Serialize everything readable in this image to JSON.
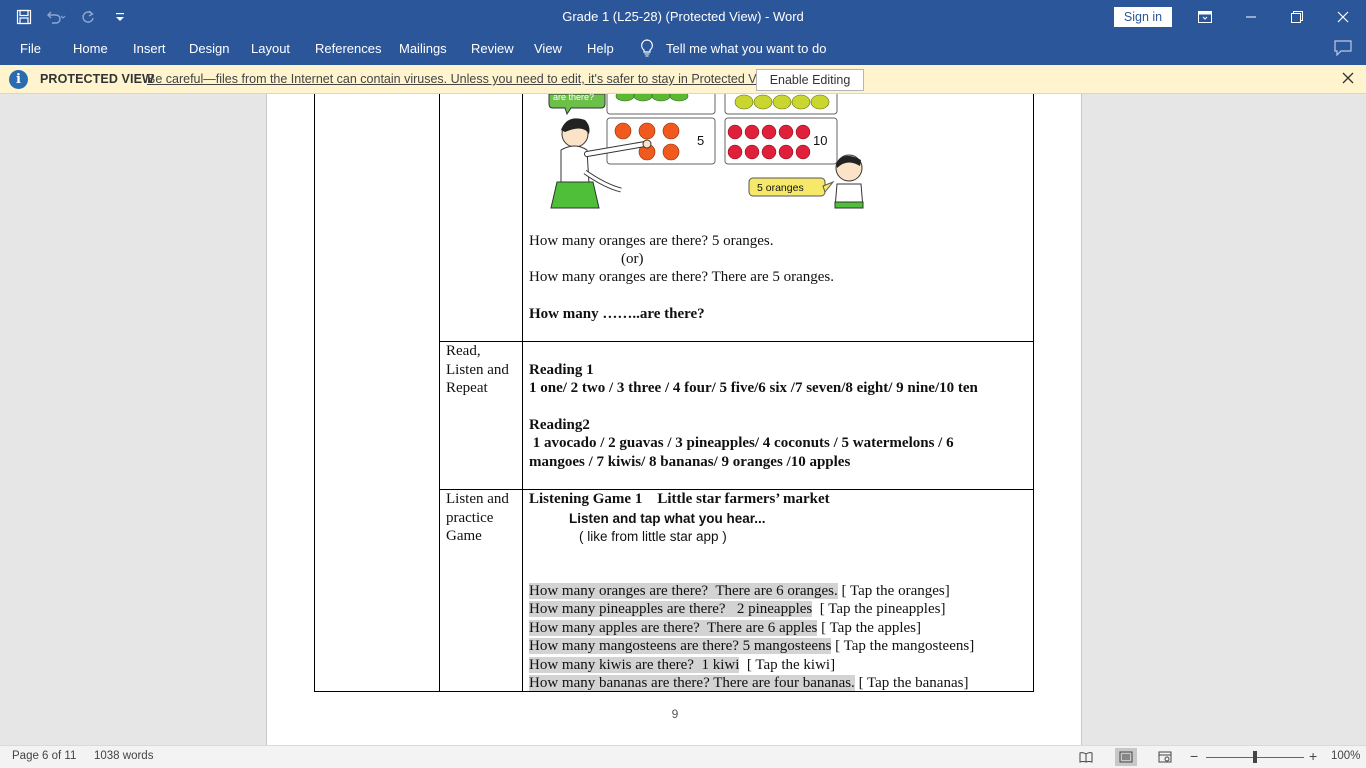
{
  "window": {
    "title": "Grade 1 (L25-28) (Protected View)  -  Word",
    "sign_in": "Sign in"
  },
  "ribbon": {
    "tabs": [
      "File",
      "Home",
      "Insert",
      "Design",
      "Layout",
      "References",
      "Mailings",
      "Review",
      "View",
      "Help"
    ],
    "tell_me": "Tell me what you want to do"
  },
  "protected_view": {
    "title": "PROTECTED VIEW",
    "message": "Be careful—files from the Internet can contain viruses. Unless you need to edit, it's safer to stay in Protected View.",
    "enable_button": "Enable Editing"
  },
  "illustration": {
    "count_small": "5",
    "count_large": "10",
    "speech_child": "5 oranges",
    "speech_teacher_partial": "are there?"
  },
  "document": {
    "intro_lines": {
      "line1": "How many oranges are there?  5 oranges.",
      "line2": "(or)",
      "line3": "How many oranges are there?  There are 5 oranges.",
      "line4": "How many ……..are there?"
    },
    "row_read": {
      "label_1": "Read,",
      "label_2": "Listen and",
      "label_3": "Repeat",
      "reading1_title": "Reading 1",
      "reading1_text": "1 one/ 2 two / 3 three / 4 four/ 5 five/6 six /7 seven/8 eight/ 9 nine/10 ten",
      "reading2_title": "Reading2",
      "reading2_line1": " 1 avocado / 2 guavas / 3 pineapples/ 4 coconuts / 5 watermelons / 6",
      "reading2_line2": "mangoes / 7 kiwis/ 8 bananas/ 9 oranges /10 apples"
    },
    "row_game": {
      "label_1": "Listen and",
      "label_2": "practice",
      "label_3": "Game",
      "title": "Listening Game 1    Little star farmers’ market",
      "subtitle": "Listen  and tap what you hear...",
      "note": "( like from little star app )",
      "qa": [
        {
          "q": "How many oranges are there?  There are 6 oranges.",
          "tap": " [ Tap the oranges]"
        },
        {
          "q": "How many pineapples are there?   2 pineapples",
          "tap": "  [ Tap the pineapples]"
        },
        {
          "q": "How many apples are there?  There are 6 apples",
          "tap": " [ Tap the apples]"
        },
        {
          "q": "How many mangosteens are there? 5 mangosteens",
          "tap": " [ Tap the mangosteens]"
        },
        {
          "q": "How many kiwis are there?  1 kiwi",
          "tap": "  [ Tap the kiwi]"
        },
        {
          "q": "How many bananas are there? There are four bananas.",
          "tap": " [ Tap the bananas]"
        }
      ]
    },
    "page_number": "9"
  },
  "status": {
    "page": "Page 6 of 11",
    "words": "1038 words",
    "zoom": "100%"
  },
  "colors": {
    "accent": "#2b579a",
    "protected_bar": "#fff4ce",
    "highlight": "#d3d3d3"
  }
}
